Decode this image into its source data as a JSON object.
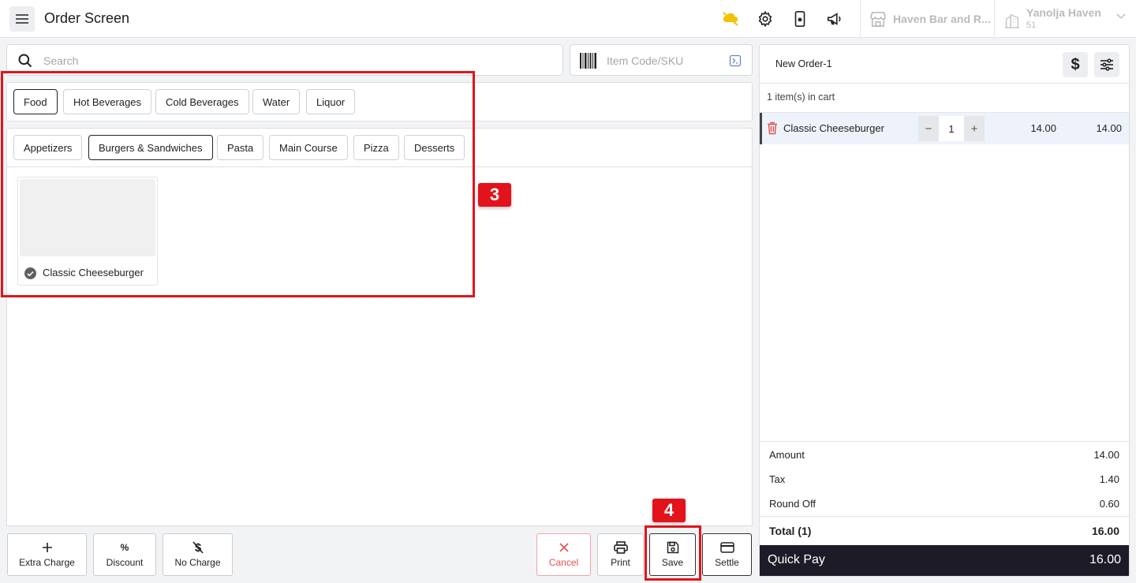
{
  "header": {
    "title": "Order Screen",
    "store_name": "Haven Bar and R...",
    "location_name": "Yanolja Haven",
    "location_sub": "51"
  },
  "search": {
    "placeholder": "Search"
  },
  "sku": {
    "placeholder": "Item Code/SKU"
  },
  "categories": [
    "Food",
    "Hot Beverages",
    "Cold Beverages",
    "Water",
    "Liquor"
  ],
  "active_category": "Food",
  "subcategories": [
    "Appetizers",
    "Burgers & Sandwiches",
    "Pasta",
    "Main Course",
    "Pizza",
    "Desserts"
  ],
  "active_subcategory": "Burgers & Sandwiches",
  "products": [
    {
      "name": "Classic Cheeseburger",
      "selected": true
    }
  ],
  "annotations": {
    "box_3": "3",
    "box_4": "4"
  },
  "actions": {
    "extra_charge": "Extra Charge",
    "discount": "Discount",
    "discount_icon": "%",
    "no_charge": "No Charge",
    "cancel": "Cancel",
    "print": "Print",
    "save": "Save",
    "settle": "Settle"
  },
  "cart": {
    "order_name": "New Order-1",
    "item_count": "1 item(s) in cart",
    "items": [
      {
        "name": "Classic Cheeseburger",
        "qty": "1",
        "price": "14.00",
        "total": "14.00"
      }
    ],
    "summary": {
      "amount_label": "Amount",
      "amount": "14.00",
      "tax_label": "Tax",
      "tax": "1.40",
      "round_label": "Round Off",
      "round": "0.60",
      "total_label": "Total (1)",
      "total": "16.00"
    },
    "quick_pay_label": "Quick Pay",
    "quick_pay_value": "16.00"
  },
  "colors": {
    "accent_red": "#e3131b",
    "quick_pay_bg": "#1d1b27",
    "weather_icon": "#f2c200"
  }
}
